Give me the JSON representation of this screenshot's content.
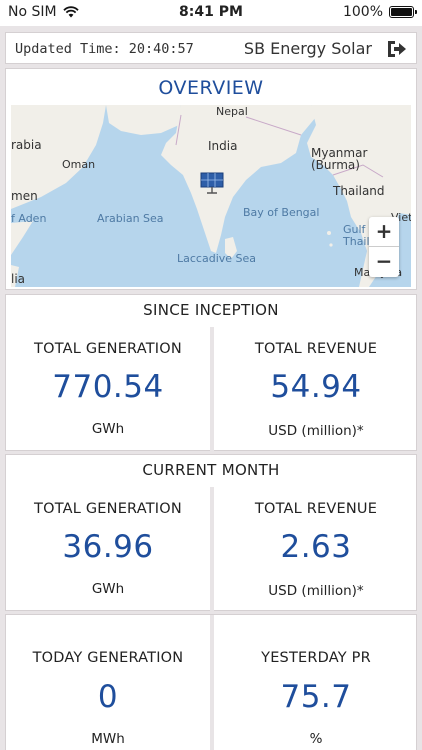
{
  "status_bar": {
    "carrier": "No SIM",
    "time": "8:41 PM",
    "battery": "100%"
  },
  "header": {
    "updated_time": "Updated Time: 20:40:57",
    "brand": "SB Energy Solar"
  },
  "overview": {
    "title": "OVERVIEW",
    "map_labels": {
      "nepal": "Nepal",
      "india": "India",
      "myanmar": "Myanmar",
      "burma": "(Burma)",
      "thailand": "Thailand",
      "arabia": "rabia",
      "oman": "Oman",
      "yemen": "men",
      "aden": "f Aden",
      "arabian_sea": "Arabian Sea",
      "bay_of_bengal": "Bay of Bengal",
      "laccadive_sea": "Laccadive Sea",
      "gulf_of": "Gulf of",
      "thailand_gulf": "Thailan",
      "viet": "Vietr",
      "malaysia": "Malaysia",
      "lia": "lia"
    },
    "zoom_in": "+",
    "zoom_out": "−"
  },
  "since_inception": {
    "title": "SINCE INCEPTION",
    "generation": {
      "label": "TOTAL GENERATION",
      "value": "770.54",
      "unit": "GWh"
    },
    "revenue": {
      "label": "TOTAL REVENUE",
      "value": "54.94",
      "unit": "USD (million)*"
    }
  },
  "current_month": {
    "title": "CURRENT MONTH",
    "generation": {
      "label": "TOTAL GENERATION",
      "value": "36.96",
      "unit": "GWh"
    },
    "revenue": {
      "label": "TOTAL REVENUE",
      "value": "2.63",
      "unit": "USD (million)*"
    }
  },
  "daily": {
    "today": {
      "label": "TODAY GENERATION",
      "value": "0",
      "unit": "MWh"
    },
    "yesterday": {
      "label": "YESTERDAY PR",
      "value": "75.7",
      "unit": "%"
    }
  },
  "colors": {
    "accent": "#1f4e9c",
    "background": "#e8e4e6",
    "water": "#b6d5ec",
    "land": "#f1efe9"
  }
}
